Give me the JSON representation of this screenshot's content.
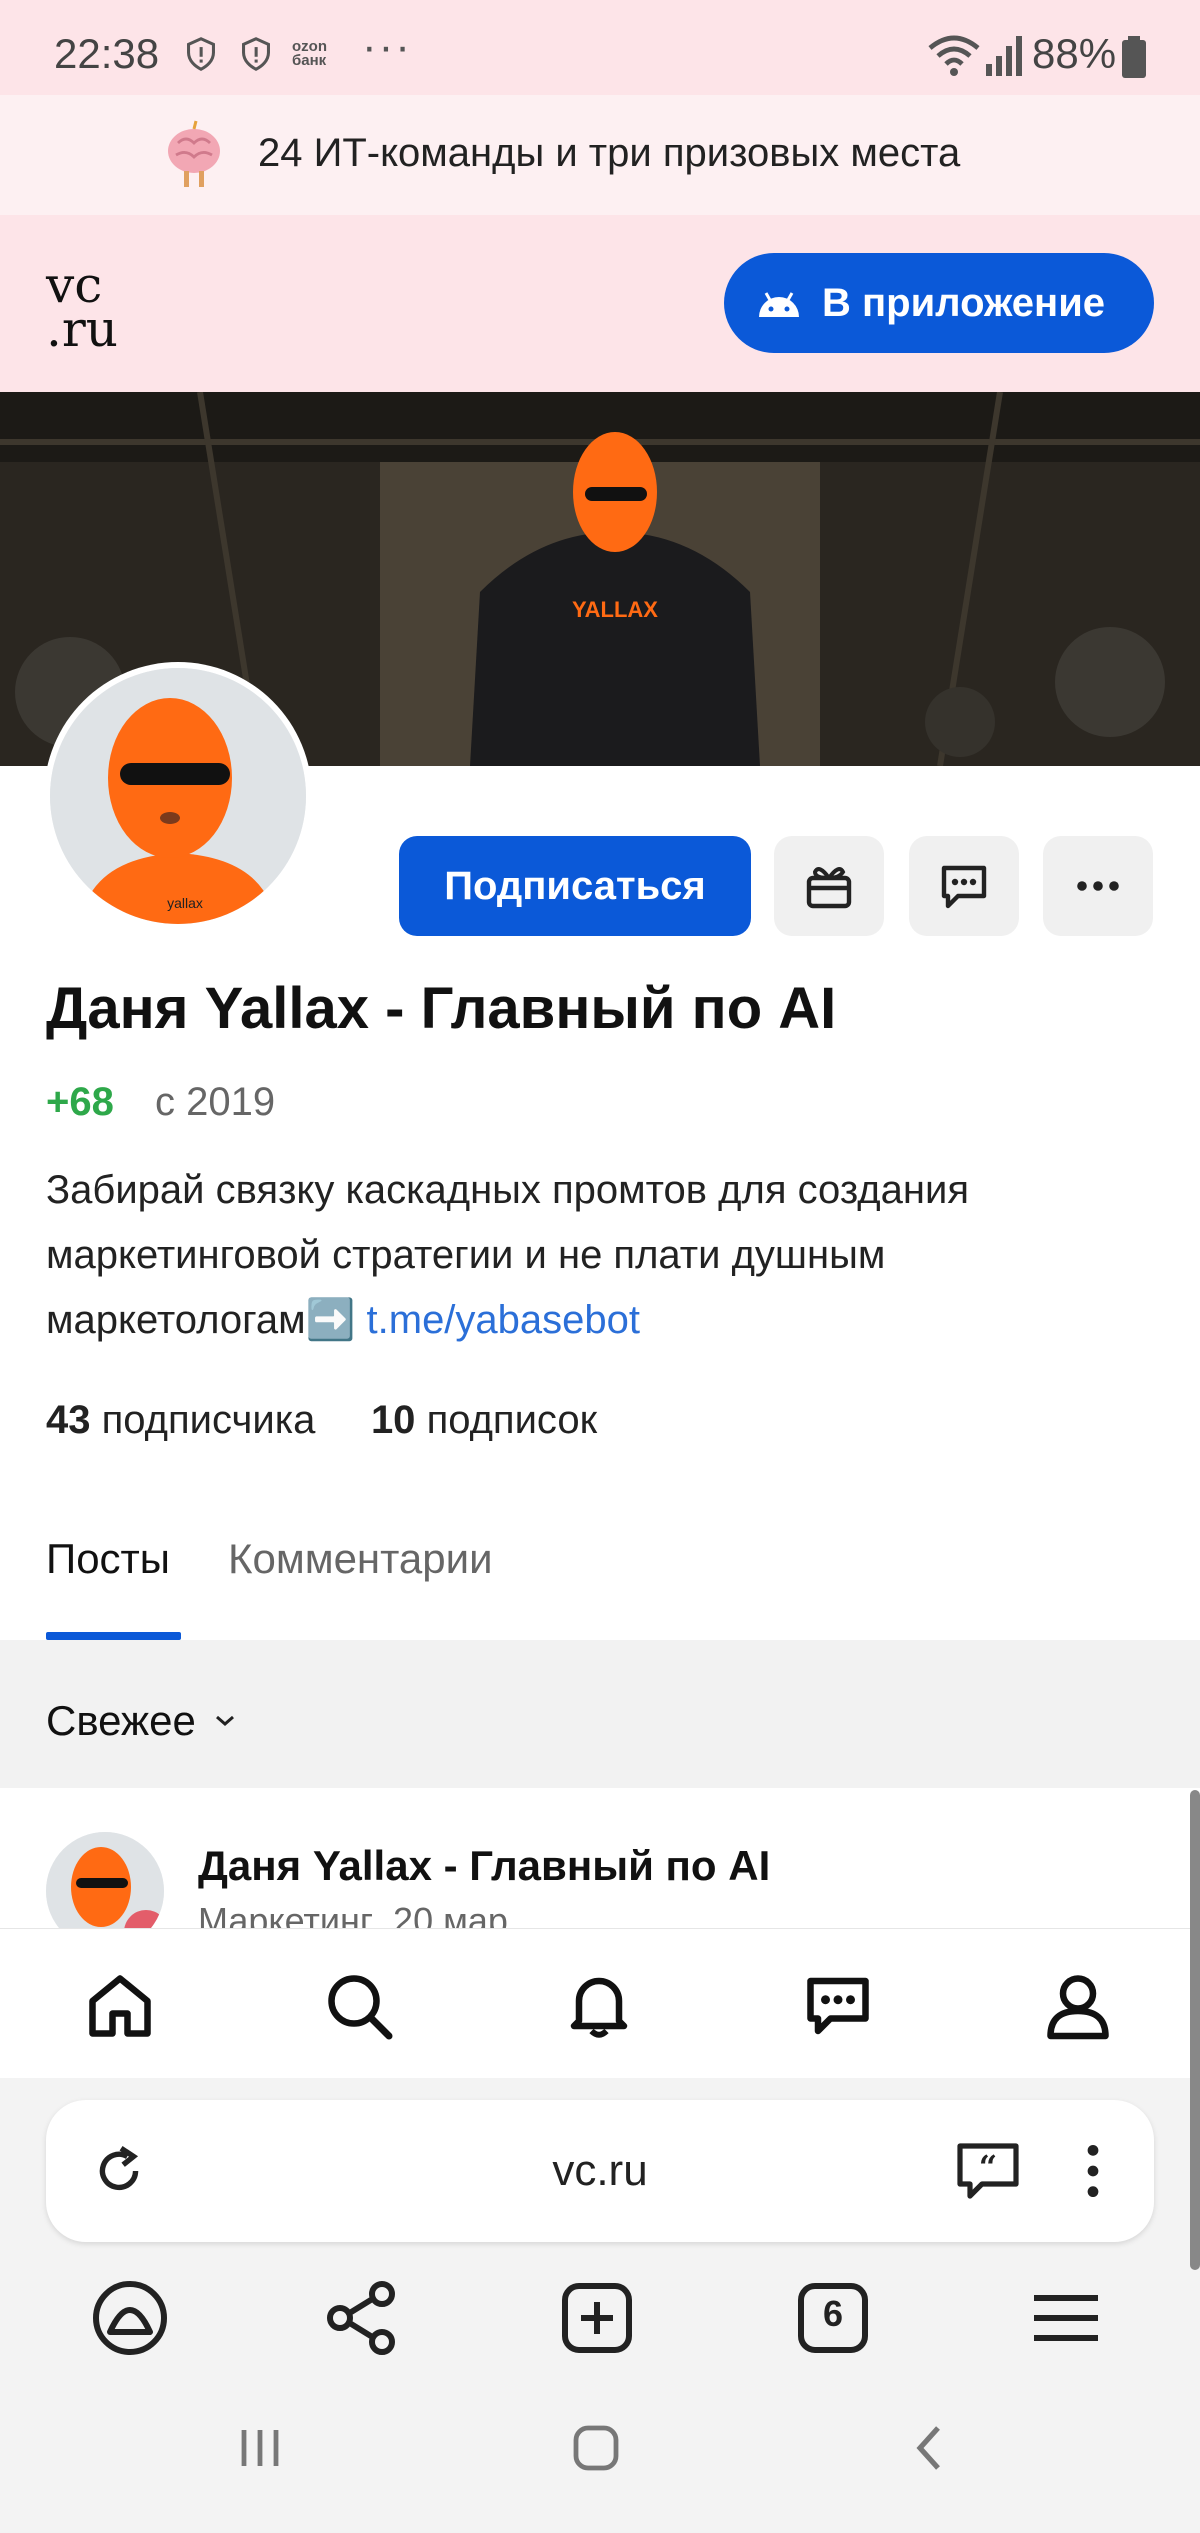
{
  "status_bar": {
    "time": "22:38",
    "bank_label": "ozon банк",
    "battery": "88%"
  },
  "promo": {
    "text": "24 ИТ-команды и три призовых места"
  },
  "header": {
    "logo": "vc.ru",
    "app_button": "В приложение"
  },
  "profile": {
    "name": "Даня Yallax - Главный по AI",
    "rating": "+68",
    "since": "с 2019",
    "bio_text": "Забирай связку каскадных промтов для создания маркетинговой стратегии и не плати душным маркетологам➡️ ",
    "bio_link": "t.me/yabasebot",
    "subscribers_count": "43",
    "subscribers_label": "подписчика",
    "subscriptions_count": "10",
    "subscriptions_label": "подписок",
    "subscribe_button": "Подписаться",
    "avatar_text": "yallax",
    "cover_text": "YALLAX"
  },
  "tabs": [
    {
      "label": "Посты",
      "active": true
    },
    {
      "label": "Комментарии",
      "active": false
    }
  ],
  "feed": {
    "sort_label": "Свежее"
  },
  "post": {
    "author": "Даня Yallax - Главный по AI",
    "category": "Маркетинг",
    "date": "20 мар"
  },
  "browser": {
    "url": "vc.ru",
    "tabs_count": "6"
  },
  "colors": {
    "accent": "#0b59d8",
    "rating_green": "#2ea84a",
    "link": "#2b6fd8",
    "header_bg": "#fde4e8"
  }
}
